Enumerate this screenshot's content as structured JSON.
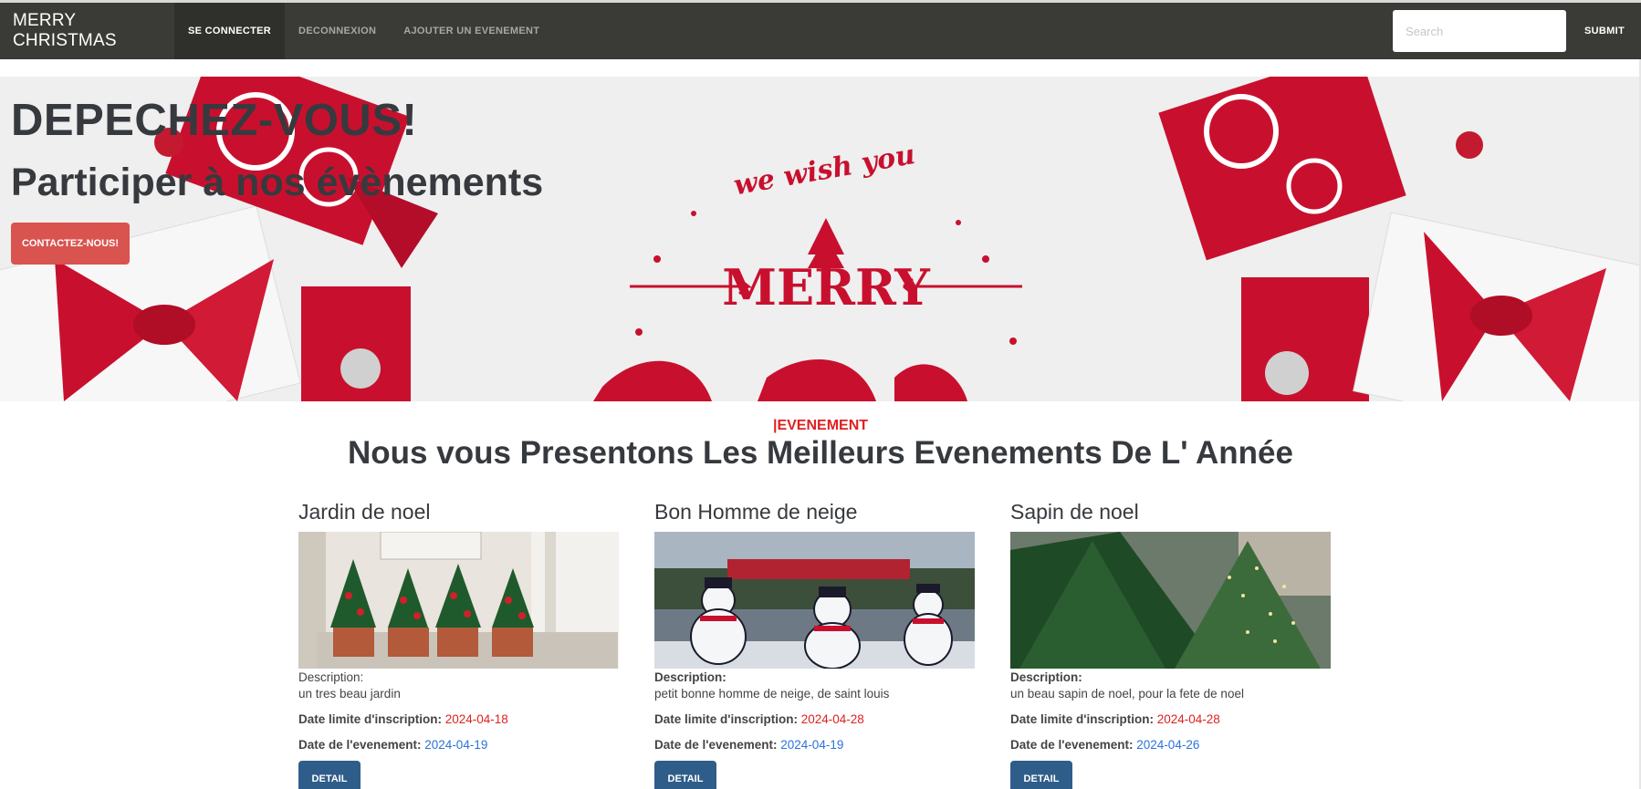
{
  "navbar": {
    "brand": "MERRY CHRISTMAS",
    "items": [
      {
        "label": "SE CONNECTER",
        "active": true
      },
      {
        "label": "DECONNEXION",
        "active": false
      },
      {
        "label": "AJOUTER UN EVENEMENT",
        "active": false
      }
    ],
    "search_placeholder": "Search",
    "submit_label": "SUBMIT"
  },
  "hero": {
    "title": "DEPECHEZ-VOUS!",
    "subtitle": "Participer à nos évènements",
    "button_label": "CONTACTEZ-NOUS!",
    "image_text_top": "we wish you",
    "image_text_main": "MERRY"
  },
  "section": {
    "tag": "|EVENEMENT",
    "title": "Nous vous Presentons Les Meilleurs Evenements De L' Année"
  },
  "labels": {
    "description": "Description:",
    "date_limit": "Date limite d'inscription:",
    "date_event": "Date de l'evenement:"
  },
  "events": [
    {
      "title": "Jardin de noel",
      "description": "un tres beau jardin",
      "date_limit": "2024-04-18",
      "date_event": "2024-04-19",
      "button_label": "DETAIL"
    },
    {
      "title": "Bon Homme de neige",
      "description": "petit bonne homme de neige, de saint louis",
      "date_limit": "2024-04-28",
      "date_event": "2024-04-19",
      "button_label": "DETAIL"
    },
    {
      "title": "Sapin de noel",
      "description": "un beau sapin de noel, pour la fete de noel",
      "date_limit": "2024-04-28",
      "date_event": "2024-04-26",
      "button_label": "DETAIL"
    }
  ],
  "colors": {
    "navbar": "#3a3a36",
    "accent_red": "#d9534f",
    "date_red": "#e02020",
    "date_blue": "#2a73d9",
    "detail_button": "#2f5d8a"
  }
}
